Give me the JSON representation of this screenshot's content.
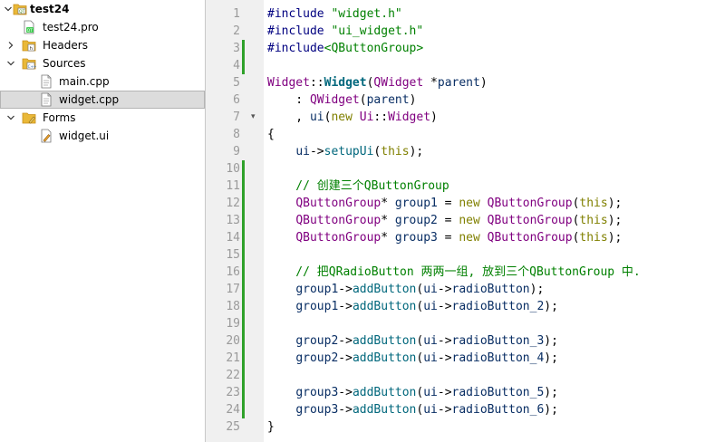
{
  "project_tree": {
    "items": [
      {
        "label": "test24",
        "icon": "project-icon",
        "bold": true,
        "twisty": "expanded",
        "depth": 0
      },
      {
        "label": "test24.pro",
        "icon": "pro-file-icon",
        "twisty": null,
        "depth": 1
      },
      {
        "label": "Headers",
        "icon": "headers-folder-icon",
        "twisty": "collapsed",
        "depth": 1
      },
      {
        "label": "Sources",
        "icon": "sources-folder-icon",
        "twisty": "expanded",
        "depth": 1
      },
      {
        "label": "main.cpp",
        "icon": "cpp-file-icon",
        "twisty": null,
        "depth": 2
      },
      {
        "label": "widget.cpp",
        "icon": "cpp-file-icon",
        "twisty": null,
        "depth": 2,
        "selected": true
      },
      {
        "label": "Forms",
        "icon": "forms-folder-icon",
        "twisty": "expanded",
        "depth": 1
      },
      {
        "label": "widget.ui",
        "icon": "ui-file-icon",
        "twisty": null,
        "depth": 2
      }
    ]
  },
  "editor": {
    "changed_lines": [
      3,
      4,
      10,
      11,
      12,
      13,
      14,
      15,
      16,
      17,
      18,
      19,
      20,
      21,
      22,
      23,
      24
    ],
    "fold_markers": [
      7
    ],
    "lines": [
      {
        "n": "1",
        "tokens": [
          [
            "#include ",
            "k-pre"
          ],
          [
            "\"widget.h\"",
            "k-str"
          ]
        ]
      },
      {
        "n": "2",
        "tokens": [
          [
            "#include ",
            "k-pre"
          ],
          [
            "\"ui_widget.h\"",
            "k-str"
          ]
        ]
      },
      {
        "n": "3",
        "tokens": [
          [
            "#include",
            "k-pre"
          ],
          [
            "<QButtonGroup>",
            "k-str"
          ]
        ]
      },
      {
        "n": "4",
        "tokens": []
      },
      {
        "n": "5",
        "tokens": [
          [
            "Widget",
            "k-cls"
          ],
          [
            "::",
            "k-txt"
          ],
          [
            "Widget",
            "k-def"
          ],
          [
            "(",
            "k-txt"
          ],
          [
            "QWidget",
            "k-cls"
          ],
          [
            " *",
            "k-txt"
          ],
          [
            "parent",
            "k-par"
          ],
          [
            ")",
            "k-txt"
          ]
        ]
      },
      {
        "n": "6",
        "tokens": [
          [
            "    : ",
            "k-txt"
          ],
          [
            "QWidget",
            "k-cls"
          ],
          [
            "(",
            "k-txt"
          ],
          [
            "parent",
            "k-par"
          ],
          [
            ")",
            "k-txt"
          ]
        ]
      },
      {
        "n": "7",
        "tokens": [
          [
            "    , ",
            "k-txt"
          ],
          [
            "ui",
            "k-var"
          ],
          [
            "(",
            "k-txt"
          ],
          [
            "new",
            "k-kw"
          ],
          [
            " ",
            "k-txt"
          ],
          [
            "Ui",
            "k-cls"
          ],
          [
            "::",
            "k-txt"
          ],
          [
            "Widget",
            "k-cls"
          ],
          [
            ")",
            "k-txt"
          ]
        ]
      },
      {
        "n": "8",
        "tokens": [
          [
            "{",
            "k-txt"
          ]
        ]
      },
      {
        "n": "9",
        "tokens": [
          [
            "    ",
            "k-txt"
          ],
          [
            "ui",
            "k-var"
          ],
          [
            "->",
            "k-txt"
          ],
          [
            "setupUi",
            "k-fn"
          ],
          [
            "(",
            "k-txt"
          ],
          [
            "this",
            "k-kw"
          ],
          [
            ");",
            "k-txt"
          ]
        ]
      },
      {
        "n": "10",
        "tokens": []
      },
      {
        "n": "11",
        "tokens": [
          [
            "    // 创建三个QButtonGroup",
            "k-cm"
          ]
        ]
      },
      {
        "n": "12",
        "tokens": [
          [
            "    ",
            "k-txt"
          ],
          [
            "QButtonGroup",
            "k-cls"
          ],
          [
            "* ",
            "k-txt"
          ],
          [
            "group1",
            "k-var"
          ],
          [
            " = ",
            "k-txt"
          ],
          [
            "new",
            "k-kw"
          ],
          [
            " ",
            "k-txt"
          ],
          [
            "QButtonGroup",
            "k-cls"
          ],
          [
            "(",
            "k-txt"
          ],
          [
            "this",
            "k-kw"
          ],
          [
            ");",
            "k-txt"
          ]
        ]
      },
      {
        "n": "13",
        "tokens": [
          [
            "    ",
            "k-txt"
          ],
          [
            "QButtonGroup",
            "k-cls"
          ],
          [
            "* ",
            "k-txt"
          ],
          [
            "group2",
            "k-var"
          ],
          [
            " = ",
            "k-txt"
          ],
          [
            "new",
            "k-kw"
          ],
          [
            " ",
            "k-txt"
          ],
          [
            "QButtonGroup",
            "k-cls"
          ],
          [
            "(",
            "k-txt"
          ],
          [
            "this",
            "k-kw"
          ],
          [
            ");",
            "k-txt"
          ]
        ]
      },
      {
        "n": "14",
        "tokens": [
          [
            "    ",
            "k-txt"
          ],
          [
            "QButtonGroup",
            "k-cls"
          ],
          [
            "* ",
            "k-txt"
          ],
          [
            "group3",
            "k-var"
          ],
          [
            " = ",
            "k-txt"
          ],
          [
            "new",
            "k-kw"
          ],
          [
            " ",
            "k-txt"
          ],
          [
            "QButtonGroup",
            "k-cls"
          ],
          [
            "(",
            "k-txt"
          ],
          [
            "this",
            "k-kw"
          ],
          [
            ");",
            "k-txt"
          ]
        ]
      },
      {
        "n": "15",
        "tokens": []
      },
      {
        "n": "16",
        "tokens": [
          [
            "    // 把QRadioButton 两两一组, 放到三个QButtonGroup 中.",
            "k-cm"
          ]
        ]
      },
      {
        "n": "17",
        "tokens": [
          [
            "    ",
            "k-txt"
          ],
          [
            "group1",
            "k-var"
          ],
          [
            "->",
            "k-txt"
          ],
          [
            "addButton",
            "k-fn"
          ],
          [
            "(",
            "k-txt"
          ],
          [
            "ui",
            "k-var"
          ],
          [
            "->",
            "k-txt"
          ],
          [
            "radioButton",
            "k-var"
          ],
          [
            ");",
            "k-txt"
          ]
        ]
      },
      {
        "n": "18",
        "tokens": [
          [
            "    ",
            "k-txt"
          ],
          [
            "group1",
            "k-var"
          ],
          [
            "->",
            "k-txt"
          ],
          [
            "addButton",
            "k-fn"
          ],
          [
            "(",
            "k-txt"
          ],
          [
            "ui",
            "k-var"
          ],
          [
            "->",
            "k-txt"
          ],
          [
            "radioButton_2",
            "k-var"
          ],
          [
            ");",
            "k-txt"
          ]
        ]
      },
      {
        "n": "19",
        "tokens": []
      },
      {
        "n": "20",
        "tokens": [
          [
            "    ",
            "k-txt"
          ],
          [
            "group2",
            "k-var"
          ],
          [
            "->",
            "k-txt"
          ],
          [
            "addButton",
            "k-fn"
          ],
          [
            "(",
            "k-txt"
          ],
          [
            "ui",
            "k-var"
          ],
          [
            "->",
            "k-txt"
          ],
          [
            "radioButton_3",
            "k-var"
          ],
          [
            ");",
            "k-txt"
          ]
        ]
      },
      {
        "n": "21",
        "tokens": [
          [
            "    ",
            "k-txt"
          ],
          [
            "group2",
            "k-var"
          ],
          [
            "->",
            "k-txt"
          ],
          [
            "addButton",
            "k-fn"
          ],
          [
            "(",
            "k-txt"
          ],
          [
            "ui",
            "k-var"
          ],
          [
            "->",
            "k-txt"
          ],
          [
            "radioButton_4",
            "k-var"
          ],
          [
            ");",
            "k-txt"
          ]
        ]
      },
      {
        "n": "22",
        "tokens": []
      },
      {
        "n": "23",
        "tokens": [
          [
            "    ",
            "k-txt"
          ],
          [
            "group3",
            "k-var"
          ],
          [
            "->",
            "k-txt"
          ],
          [
            "addButton",
            "k-fn"
          ],
          [
            "(",
            "k-txt"
          ],
          [
            "ui",
            "k-var"
          ],
          [
            "->",
            "k-txt"
          ],
          [
            "radioButton_5",
            "k-var"
          ],
          [
            ");",
            "k-txt"
          ]
        ]
      },
      {
        "n": "24",
        "tokens": [
          [
            "    ",
            "k-txt"
          ],
          [
            "group3",
            "k-var"
          ],
          [
            "->",
            "k-txt"
          ],
          [
            "addButton",
            "k-fn"
          ],
          [
            "(",
            "k-txt"
          ],
          [
            "ui",
            "k-var"
          ],
          [
            "->",
            "k-txt"
          ],
          [
            "radioButton_6",
            "k-var"
          ],
          [
            ");",
            "k-txt"
          ]
        ]
      },
      {
        "n": "25",
        "tokens": [
          [
            "}",
            "k-txt"
          ]
        ]
      }
    ]
  }
}
